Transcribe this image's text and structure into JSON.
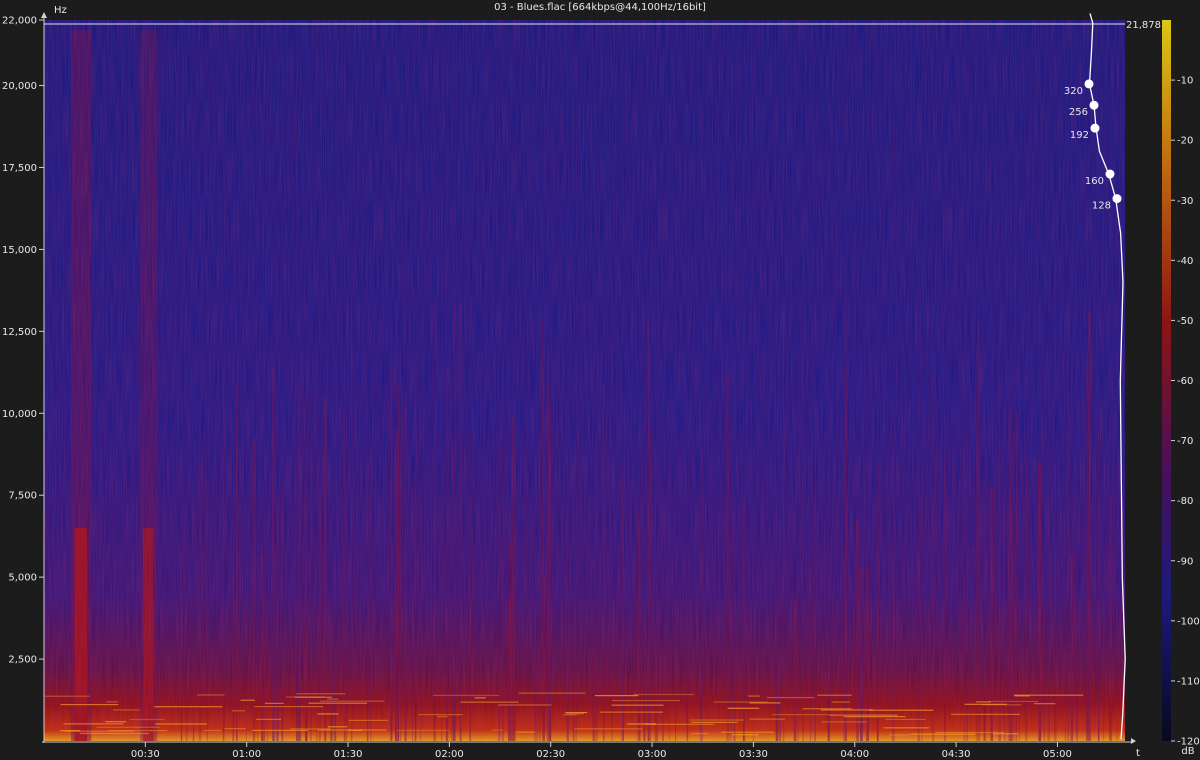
{
  "title": "03 - Blues.flac [664kbps@44,100Hz/16bit]",
  "chart_data": {
    "type": "heatmap",
    "ylabel": "Hz",
    "xlabel": "t",
    "colorbar_label": "dB",
    "ylim": [
      0,
      22000
    ],
    "yticks": [
      {
        "value": 22000,
        "label": "22,000"
      },
      {
        "value": 20000,
        "label": "20,000"
      },
      {
        "value": 17500,
        "label": "17,500"
      },
      {
        "value": 15000,
        "label": "15,000"
      },
      {
        "value": 12500,
        "label": "12,500"
      },
      {
        "value": 10000,
        "label": "10,000"
      },
      {
        "value": 7500,
        "label": "7,500"
      },
      {
        "value": 5000,
        "label": "5,000"
      },
      {
        "value": 2500,
        "label": "2,500"
      }
    ],
    "xticks": [
      {
        "value": 30,
        "label": "00:30"
      },
      {
        "value": 60,
        "label": "01:00"
      },
      {
        "value": 90,
        "label": "01:30"
      },
      {
        "value": 120,
        "label": "02:00"
      },
      {
        "value": 150,
        "label": "02:30"
      },
      {
        "value": 180,
        "label": "03:00"
      },
      {
        "value": 210,
        "label": "03:30"
      },
      {
        "value": 240,
        "label": "04:00"
      },
      {
        "value": 270,
        "label": "04:30"
      },
      {
        "value": 300,
        "label": "05:00"
      }
    ],
    "duration_seconds": 320,
    "cutoff": {
      "value": 21878,
      "label": "21,878"
    },
    "colorbar_range_db": [
      -120,
      0
    ],
    "colorbar_ticks": [
      "-10",
      "-20",
      "-30",
      "-40",
      "-50",
      "-60",
      "-70",
      "-80",
      "-90",
      "-100",
      "-110",
      "-120"
    ],
    "colors": {
      "background": "#1c1c1c",
      "low": "#1a1878",
      "mid": "#8b0f1c",
      "high": "#f2d21a",
      "line": "#ffffff"
    },
    "bitrate_markers": [
      {
        "label": "320",
        "freq": 20050
      },
      {
        "label": "256",
        "freq": 19400
      },
      {
        "label": "192",
        "freq": 18700
      },
      {
        "label": "160",
        "freq": 17300
      },
      {
        "label": "128",
        "freq": 16550
      }
    ]
  }
}
